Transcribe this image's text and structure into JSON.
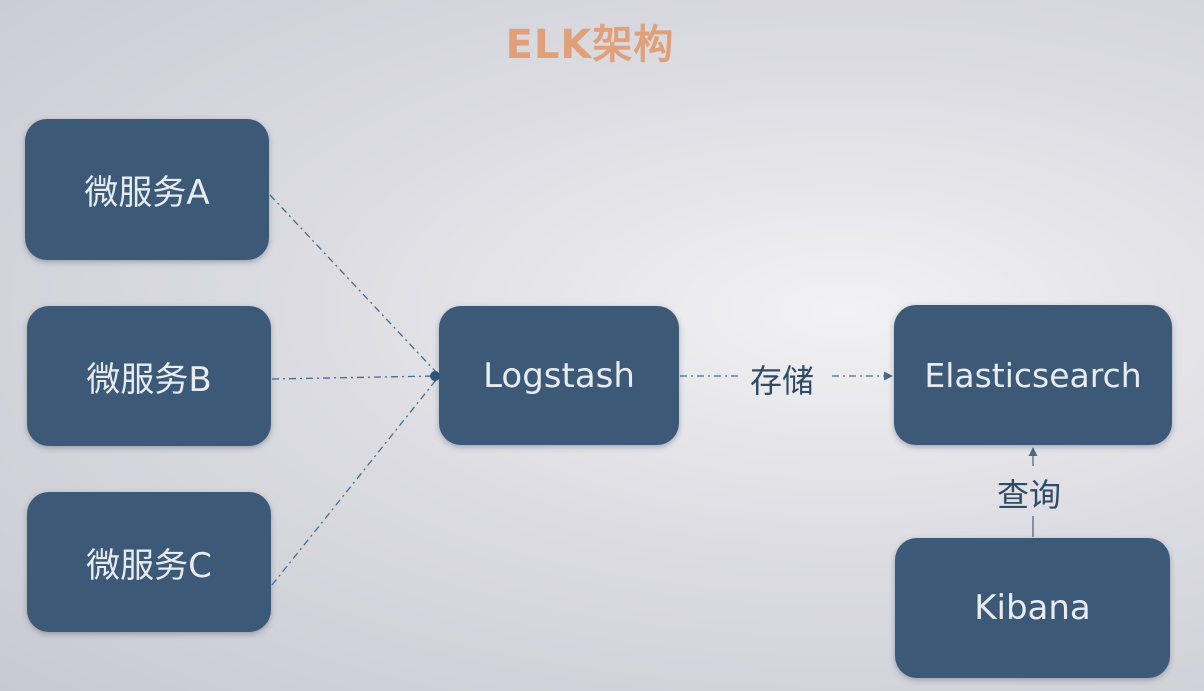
{
  "title": "ELK架构",
  "nodes": {
    "service_a": "微服务A",
    "service_b": "微服务B",
    "service_c": "微服务C",
    "logstash": "Logstash",
    "elasticsearch": "Elasticsearch",
    "kibana": "Kibana"
  },
  "edges": {
    "store_label": "存储",
    "query_label": "查询"
  },
  "colors": {
    "node_fill": "#3c5a78",
    "title": "#e0a07a",
    "connector": "#4a6a8a"
  }
}
